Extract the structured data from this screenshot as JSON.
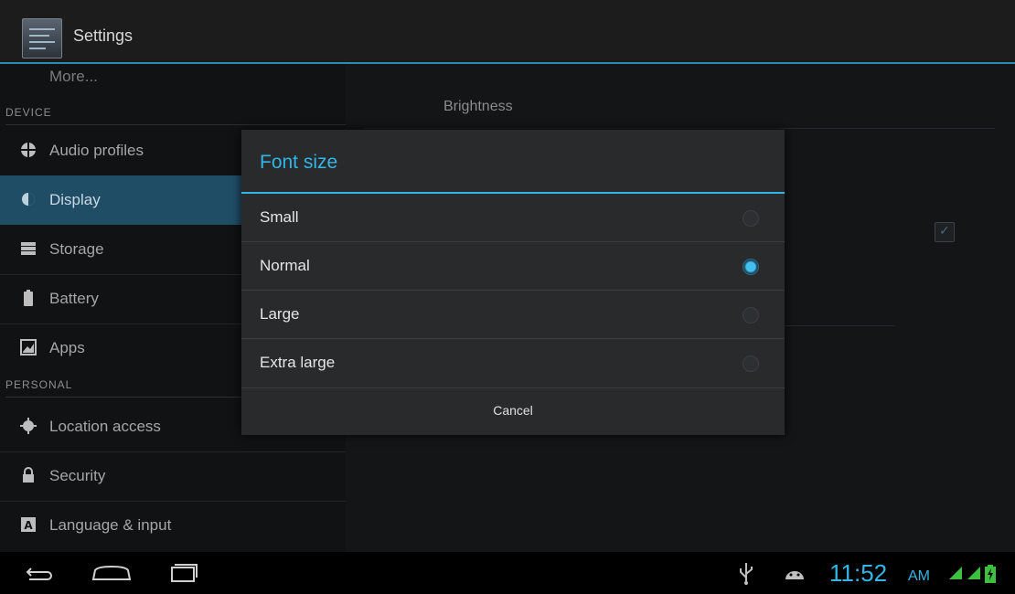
{
  "action_bar": {
    "title": "Settings"
  },
  "left_list": {
    "partial_item": "More...",
    "device_header": "DEVICE",
    "personal_header": "PERSONAL",
    "device_items": [
      {
        "label": "Audio profiles",
        "icon": "audio-profiles-icon"
      },
      {
        "label": "Display",
        "icon": "display-icon",
        "selected": true
      },
      {
        "label": "Storage",
        "icon": "storage-icon"
      },
      {
        "label": "Battery",
        "icon": "battery-icon"
      },
      {
        "label": "Apps",
        "icon": "apps-icon"
      }
    ],
    "personal_items": [
      {
        "label": "Location access",
        "icon": "location-icon"
      },
      {
        "label": "Security",
        "icon": "lock-icon"
      },
      {
        "label": "Language & input",
        "icon": "language-icon"
      }
    ]
  },
  "detail_pane": {
    "brightness_label": "Brightness"
  },
  "dialog": {
    "title": "Font size",
    "options": [
      {
        "label": "Small",
        "checked": false
      },
      {
        "label": "Normal",
        "checked": true
      },
      {
        "label": "Large",
        "checked": false
      },
      {
        "label": "Extra large",
        "checked": false
      }
    ],
    "cancel_label": "Cancel"
  },
  "system_bar": {
    "time": "11:52",
    "ampm": "AM",
    "accent": "#33b5e5"
  }
}
